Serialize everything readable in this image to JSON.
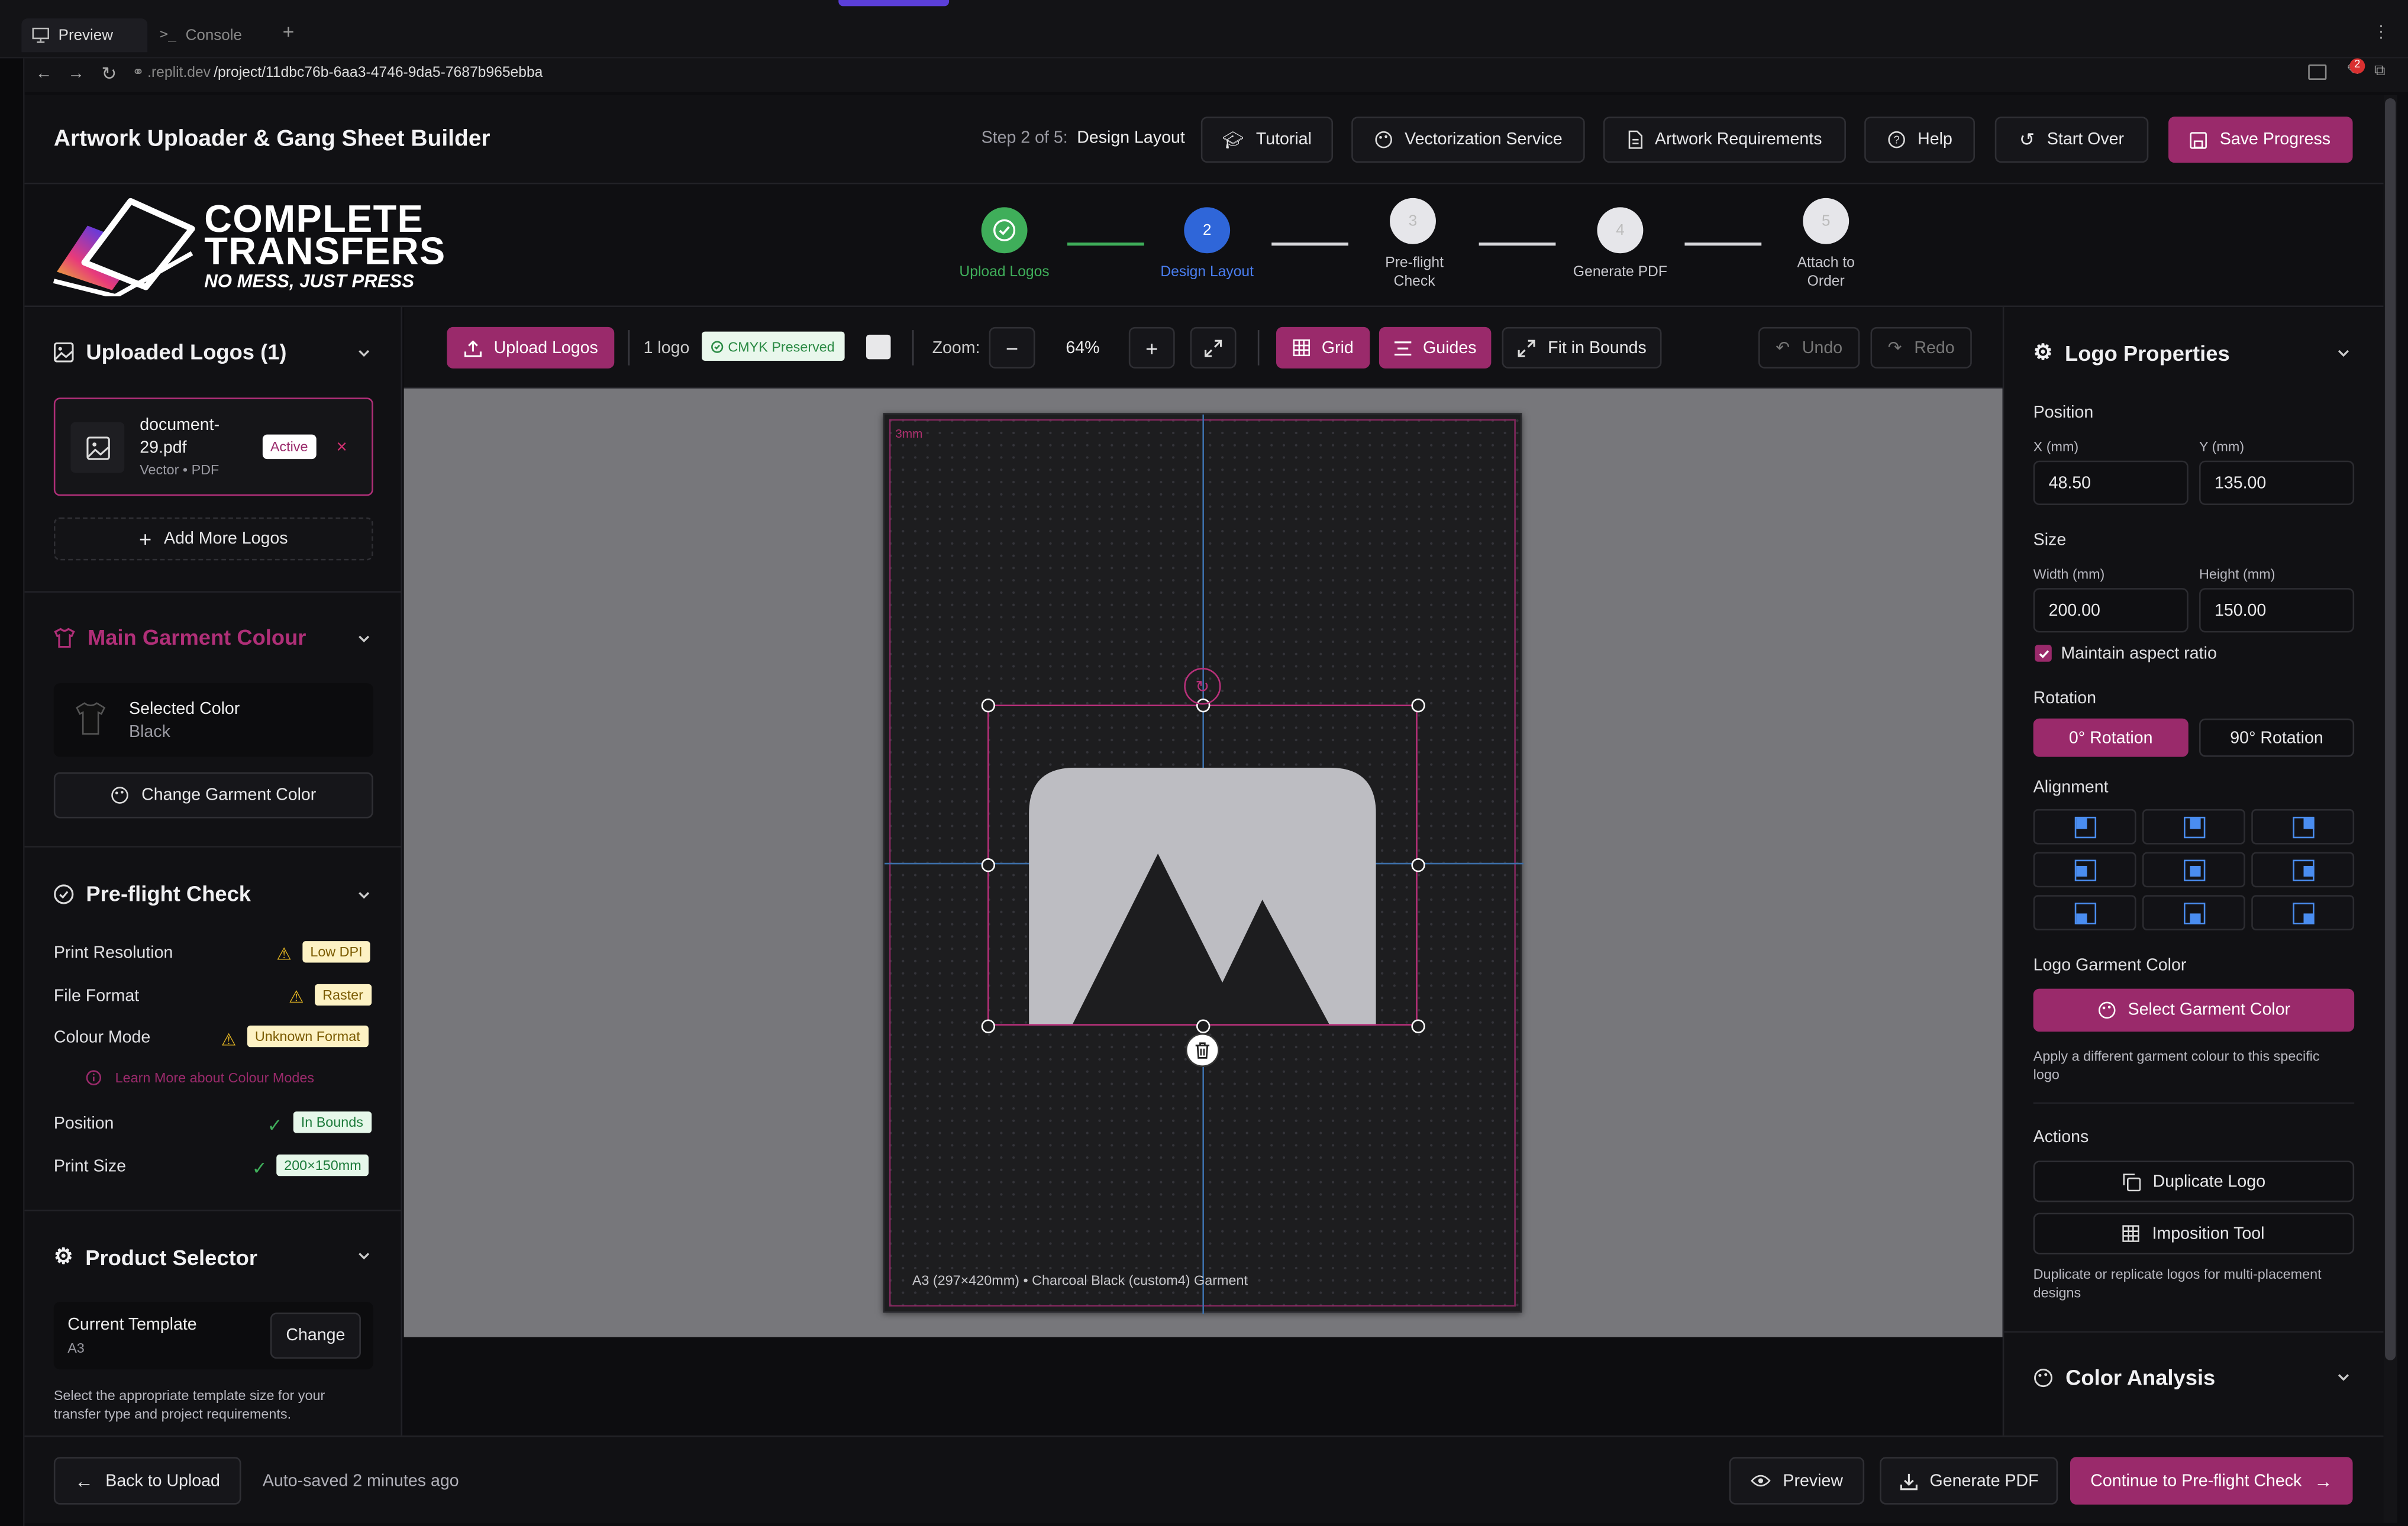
{
  "browser": {
    "tabs": [
      {
        "label": "Preview",
        "icon": "monitor-icon"
      },
      {
        "label": "Console",
        "icon": "terminal-icon"
      }
    ],
    "url_domain": ".replit.dev",
    "url_path": "/project/11dbc76b-6aa3-4746-9da5-7687b965ebba",
    "notification_count": "2"
  },
  "header": {
    "title": "Artwork Uploader & Gang Sheet Builder",
    "step_prefix": "Step 2 of 5:",
    "step_name": "Design Layout",
    "buttons": {
      "tutorial": "Tutorial",
      "vectorization": "Vectorization Service",
      "requirements": "Artwork Requirements",
      "help": "Help",
      "start_over": "Start Over",
      "save": "Save Progress"
    }
  },
  "logo": {
    "line1": "COMPLETE",
    "line2": "TRANSFERS",
    "tagline": "NO MESS, JUST PRESS"
  },
  "stepper": [
    {
      "number": "✓",
      "label": "Upload Logos",
      "state": "done"
    },
    {
      "number": "2",
      "label": "Design Layout",
      "state": "active"
    },
    {
      "number": "3",
      "label": "Pre-flight Check",
      "state": "pending"
    },
    {
      "number": "4",
      "label": "Generate PDF",
      "state": "pending"
    },
    {
      "number": "5",
      "label": "Attach to Order",
      "state": "pending"
    }
  ],
  "left": {
    "uploaded": {
      "title": "Uploaded Logos (1)",
      "file_name": "document-29.pdf",
      "file_meta": "Vector • PDF",
      "active": "Active",
      "remove": "×",
      "add_more": "Add More Logos"
    },
    "garment": {
      "title": "Main Garment Colour",
      "selected_label": "Selected Color",
      "selected_value": "Black",
      "change": "Change Garment Color"
    },
    "preflight": {
      "title": "Pre-flight Check",
      "rows": [
        {
          "label": "Print Resolution",
          "status": "warn",
          "badge": "Low DPI"
        },
        {
          "label": "File Format",
          "status": "warn",
          "badge": "Raster"
        },
        {
          "label": "Colour Mode",
          "status": "warn",
          "badge": "Unknown Format"
        },
        {
          "label": "Position",
          "status": "ok",
          "badge": "In Bounds"
        },
        {
          "label": "Print Size",
          "status": "ok",
          "badge": "200×150mm"
        }
      ],
      "learn_more": "Learn More about Colour Modes"
    },
    "product": {
      "title": "Product Selector",
      "current_label": "Current Template",
      "current_value": "A3",
      "change": "Change",
      "help": "Select the appropriate template size for your transfer type and project requirements."
    }
  },
  "toolbar": {
    "upload": "Upload Logos",
    "logo_count": "1 logo",
    "cmyk": "CMYK Preserved",
    "zoom_label": "Zoom:",
    "zoom_value": "64%",
    "grid": "Grid",
    "guides": "Guides",
    "fit": "Fit in Bounds",
    "undo": "Undo",
    "redo": "Redo"
  },
  "canvas": {
    "bleed_label": "3mm",
    "footer": "A3 (297×420mm) • Charcoal Black (custom4) Garment"
  },
  "right": {
    "title": "Logo Properties",
    "position_label": "Position",
    "x_label": "X (mm)",
    "x_value": "48.50",
    "y_label": "Y (mm)",
    "y_value": "135.00",
    "size_label": "Size",
    "w_label": "Width (mm)",
    "w_value": "200.00",
    "h_label": "Height (mm)",
    "h_value": "150.00",
    "aspect": "Maintain aspect ratio",
    "rotation_label": "Rotation",
    "rot0": "0° Rotation",
    "rot90": "90° Rotation",
    "alignment_label": "Alignment",
    "logo_garment_label": "Logo Garment Color",
    "select_garment": "Select Garment Color",
    "garment_help": "Apply a different garment colour to this specific logo",
    "actions_label": "Actions",
    "duplicate": "Duplicate Logo",
    "imposition": "Imposition Tool",
    "actions_help": "Duplicate or replicate logos for multi-placement designs",
    "color_analysis": "Color Analysis"
  },
  "footer": {
    "back": "Back to Upload",
    "autosave": "Auto-saved 2 minutes ago",
    "preview": "Preview",
    "generate": "Generate PDF",
    "continue": "Continue to Pre-flight Check"
  },
  "colors": {
    "accent": "#9a2a6b",
    "blue": "#2f66d9",
    "green": "#3fae5a"
  }
}
